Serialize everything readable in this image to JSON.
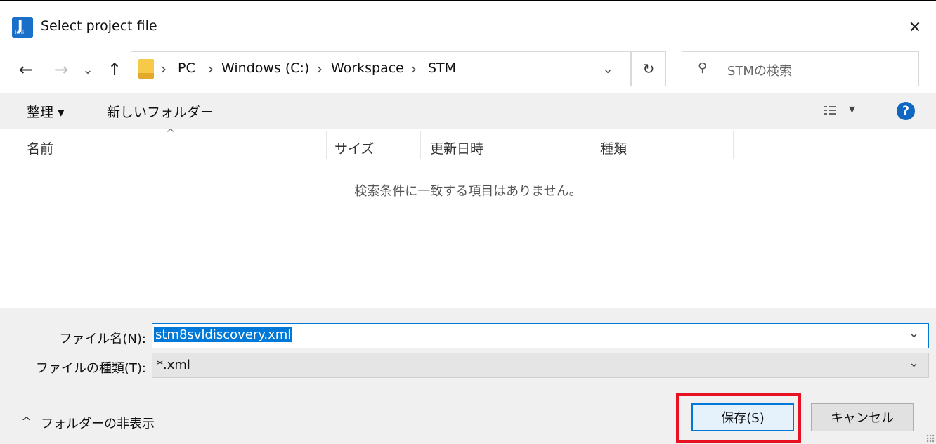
{
  "window": {
    "app_icon_letter": "J",
    "app_icon_sub": "Uni",
    "title": "Select project file",
    "close_glyph": "✕"
  },
  "nav": {
    "back_glyph": "←",
    "forward_glyph": "→",
    "recent_glyph": "⌄",
    "up_glyph": "↑",
    "breadcrumb_sep": "›",
    "breadcrumbs": [
      "PC",
      "Windows (C:)",
      "Workspace",
      "STM"
    ],
    "dropdown_glyph": "⌄",
    "refresh_glyph": "↻"
  },
  "search": {
    "icon_glyph": "⚲",
    "placeholder": "STMの検索"
  },
  "toolbar": {
    "organize_label": "整理 ▾",
    "new_folder_label": "新しいフォルダー",
    "view_glyph": "▾",
    "help_glyph": "?"
  },
  "file_list": {
    "sort_glyph": "^",
    "columns": [
      "名前",
      "サイズ",
      "更新日時",
      "種類"
    ],
    "empty_message": "検索条件に一致する項目はありません。"
  },
  "form": {
    "filename_label": "ファイル名(N):",
    "filename_value": "stm8svldiscovery.xml",
    "filetype_label": "ファイルの種類(T):",
    "filetype_value": "*.xml",
    "dropdown_glyph": "⌄"
  },
  "footer": {
    "hide_folders_glyph": "^",
    "hide_folders_label": "フォルダーの非表示",
    "save_label": "保存(S)",
    "cancel_label": "キャンセル"
  },
  "colors": {
    "accent": "#0078d7",
    "selection": "#0078d7",
    "highlight_border": "#e81123"
  }
}
